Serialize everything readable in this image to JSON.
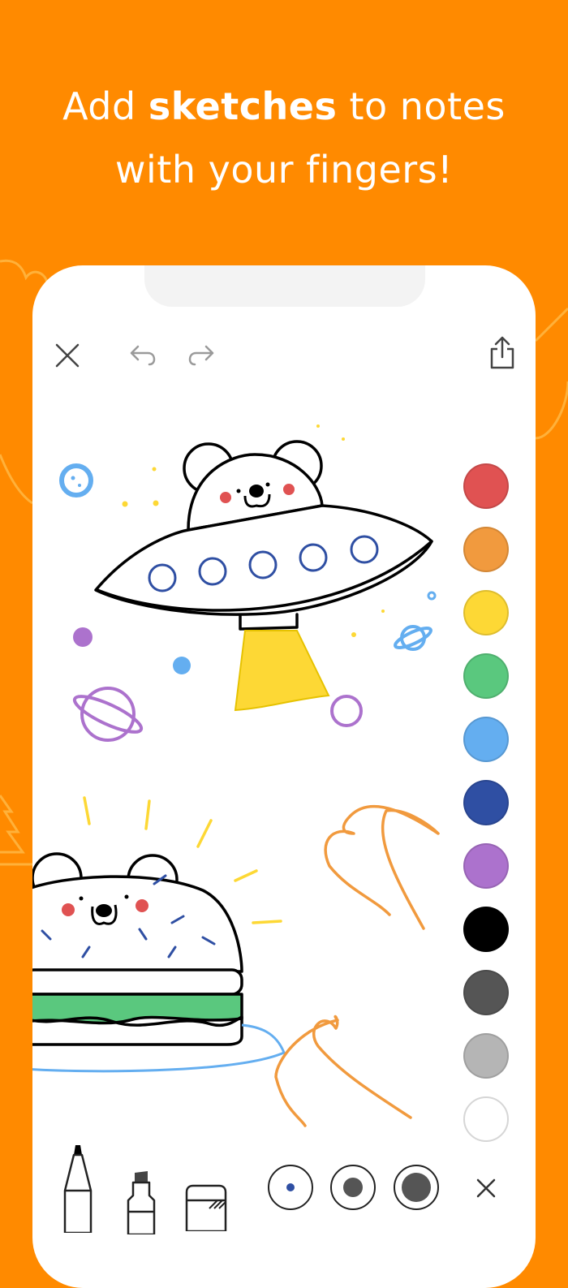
{
  "headline": {
    "line1_pre": "Add ",
    "line1_bold": "sketches",
    "line1_post": " to notes",
    "line2": "with your fingers!"
  },
  "toolbar": {
    "close_icon": "close-icon",
    "undo_icon": "undo-icon",
    "redo_icon": "redo-icon",
    "share_icon": "share-icon"
  },
  "palette": {
    "colors": [
      {
        "name": "red",
        "hex": "#e05252"
      },
      {
        "name": "orange",
        "hex": "#f19a3e"
      },
      {
        "name": "yellow",
        "hex": "#fdd835"
      },
      {
        "name": "green",
        "hex": "#5ac87e"
      },
      {
        "name": "light-blue",
        "hex": "#64aef0"
      },
      {
        "name": "dark-blue",
        "hex": "#2f4fa3"
      },
      {
        "name": "purple",
        "hex": "#ac72cd"
      },
      {
        "name": "black",
        "hex": "#000000"
      },
      {
        "name": "dark-gray",
        "hex": "#555555"
      },
      {
        "name": "light-gray",
        "hex": "#b5b5b5"
      },
      {
        "name": "white",
        "hex": "#ffffff"
      }
    ]
  },
  "tools": {
    "pen_icon": "pen-icon",
    "marker_icon": "marker-icon",
    "eraser_icon": "eraser-icon",
    "sizes": [
      "small",
      "medium",
      "large"
    ],
    "selected_color": "#2f4fa3",
    "close_icon": "close-tools-icon"
  },
  "colors": {
    "background": "#ff8a00",
    "canvas": "#ffffff",
    "stroke": "#000000"
  }
}
